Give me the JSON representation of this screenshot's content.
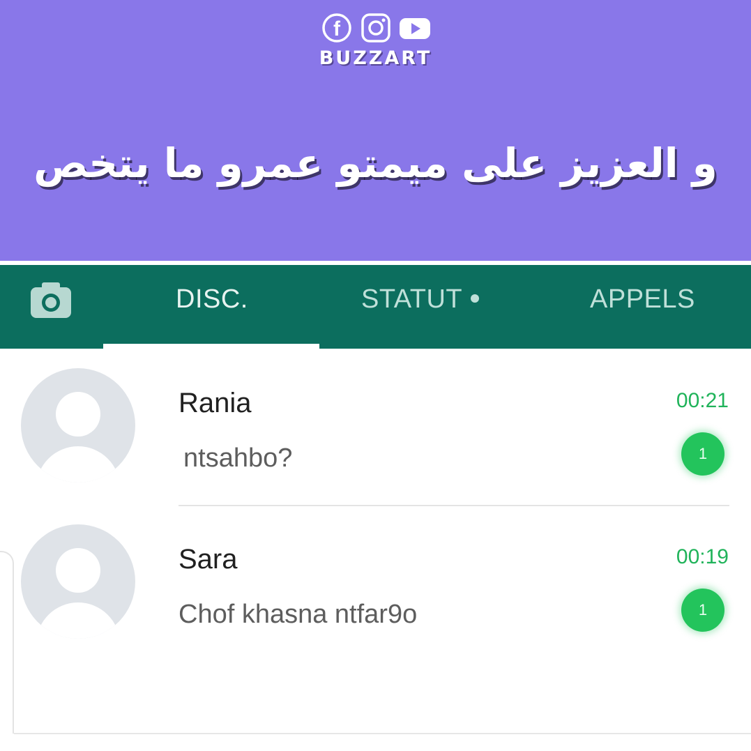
{
  "brand": {
    "name": "BUZZART",
    "icons": [
      "facebook-icon",
      "instagram-icon",
      "youtube-icon"
    ]
  },
  "caption": "و العزيز على ميمتو عمرو ما يتخص",
  "colors": {
    "banner": "#8977e9",
    "app_bar": "#0c6e5e",
    "accent_green": "#23c45c",
    "time_green": "#20b35a"
  },
  "tabs": [
    {
      "label": "DISC.",
      "active": true
    },
    {
      "label": "STATUT",
      "active": false,
      "has_dot": true
    },
    {
      "label": "APPELS",
      "active": false
    }
  ],
  "chats": [
    {
      "name": "Rania",
      "preview": "ntsahbo?",
      "time": "00:21",
      "unread": "1"
    },
    {
      "name": "Sara",
      "preview": "Chof khasna ntfar9o",
      "time": "00:19",
      "unread": "1"
    }
  ]
}
